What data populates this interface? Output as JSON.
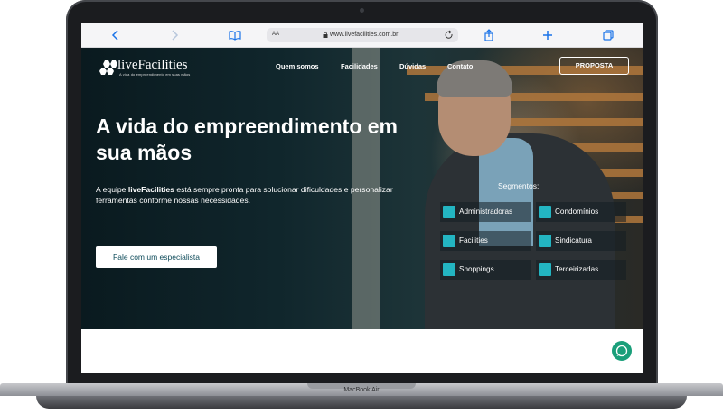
{
  "browser": {
    "url": "www.livefacilities.com.br",
    "reader_label": "AA"
  },
  "site": {
    "logo_text": "liveFacilities",
    "logo_tagline": "A vida do empreendimento em suas mãos",
    "nav": [
      {
        "label": "Quem somos"
      },
      {
        "label": "Facilidades"
      },
      {
        "label": "Dúvidas"
      },
      {
        "label": "Contato"
      }
    ],
    "proposal_button": "PROPOSTA",
    "headline_line1": "A vida do empreendimento em",
    "headline_line2": "sua mãos",
    "description_prefix": "A equipe ",
    "description_brand": "liveFacilities",
    "description_suffix": " está sempre pronta para solucionar dificuldades e personalizar ferramentas conforme nossas necessidades.",
    "cta_button": "Fale com um especialista",
    "segments_title": "Segmentos:",
    "segments": [
      {
        "label": "Administradoras",
        "icon": "chart-icon"
      },
      {
        "label": "Condomínios",
        "icon": "building-icon"
      },
      {
        "label": "Facilities",
        "icon": "tools-icon"
      },
      {
        "label": "Sindicatura",
        "icon": "eye-icon"
      },
      {
        "label": "Shoppings",
        "icon": "store-icon"
      },
      {
        "label": "Terceirizadas",
        "icon": "person-icon"
      }
    ],
    "accent_color": "#23b5c2",
    "cta_text_color": "#0e4b5a",
    "whatsapp_color": "#1a9f7a"
  },
  "device": {
    "label": "MacBook Air"
  }
}
